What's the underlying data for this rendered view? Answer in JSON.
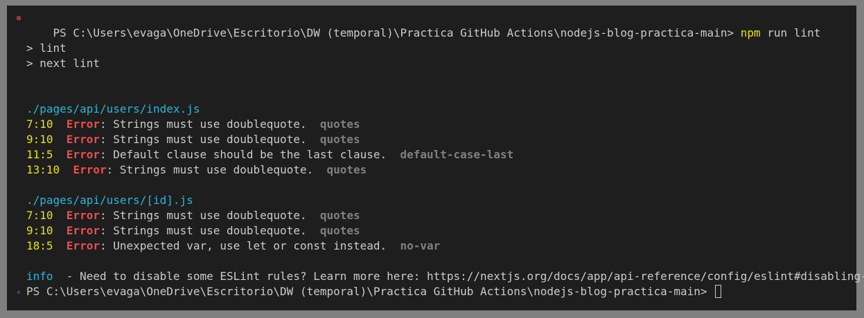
{
  "prompt": {
    "text": "PS C:\\Users\\evaga\\OneDrive\\Escritorio\\DW (temporal)\\Practica GitHub Actions\\nodejs-blog-practica-main>",
    "command_bin": "npm",
    "command_args": "run lint"
  },
  "script_lines": [
    "> lint",
    "> next lint"
  ],
  "files": [
    {
      "path": "./pages/api/users/index.js",
      "errors": [
        {
          "loc": "7:10",
          "label": "Error",
          "message": ": Strings must use doublequote.",
          "rule": "quotes"
        },
        {
          "loc": "9:10",
          "label": "Error",
          "message": ": Strings must use doublequote.",
          "rule": "quotes"
        },
        {
          "loc": "11:5",
          "label": "Error",
          "message": ": Default clause should be the last clause.",
          "rule": "default-case-last"
        },
        {
          "loc": "13:10",
          "label": "Error",
          "message": ": Strings must use doublequote.",
          "rule": "quotes"
        }
      ]
    },
    {
      "path": "./pages/api/users/[id].js",
      "errors": [
        {
          "loc": "7:10",
          "label": "Error",
          "message": ": Strings must use doublequote.",
          "rule": "quotes"
        },
        {
          "loc": "9:10",
          "label": "Error",
          "message": ": Strings must use doublequote.",
          "rule": "quotes"
        },
        {
          "loc": "18:5",
          "label": "Error",
          "message": ": Unexpected var, use let or const instead.",
          "rule": "no-var"
        }
      ]
    }
  ],
  "info": {
    "label": "info",
    "message": "  - Need to disable some ESLint rules? Learn more here: https://nextjs.org/docs/app/api-reference/config/eslint#disabling-rules"
  },
  "final_prompt": {
    "text": "PS C:\\Users\\evaga\\OneDrive\\Escritorio\\DW (temporal)\\Practica GitHub Actions\\nodejs-blog-practica-main>"
  },
  "icons": {
    "error_gutter": "error-circle-icon",
    "sparkle_gutter": "sparkle-icon"
  },
  "colors": {
    "background": "#1e1e1e",
    "text": "#cccccc",
    "error": "#f14c4c",
    "path": "#29b8db",
    "location": "#e5e510",
    "rule": "#808080"
  }
}
